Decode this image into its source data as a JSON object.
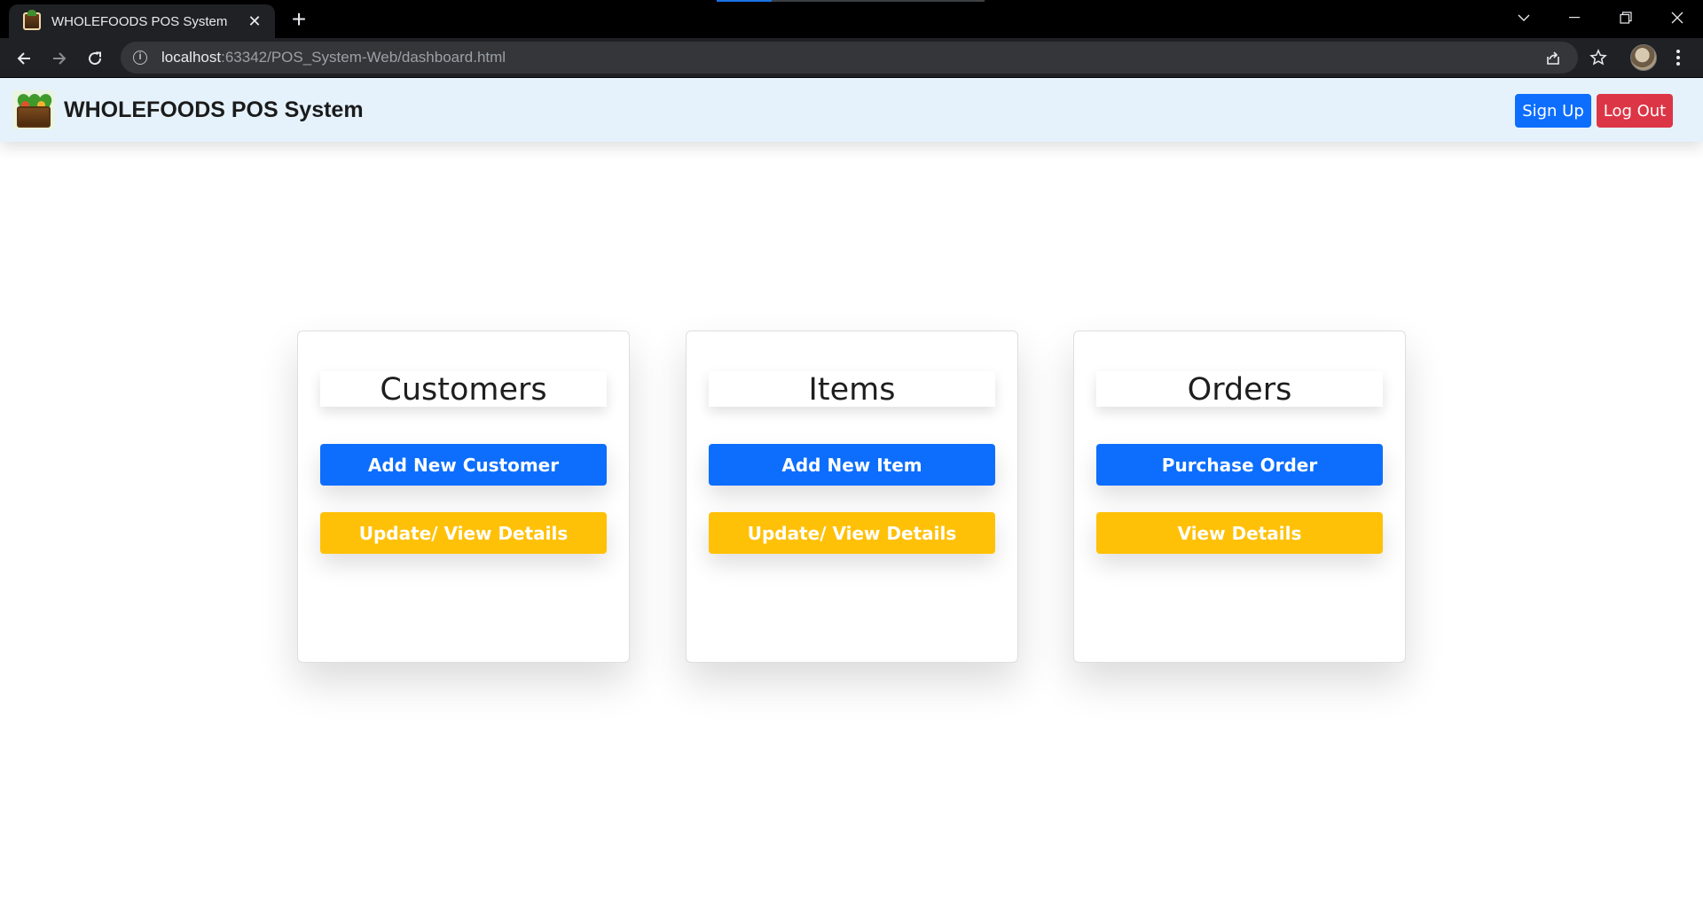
{
  "browser": {
    "tab_title": "WHOLEFOODS POS System",
    "url_host": "localhost",
    "url_rest": ":63342/POS_System-Web/dashboard.html"
  },
  "navbar": {
    "brand": "WHOLEFOODS POS System",
    "signup_label": "Sign Up",
    "logout_label": "Log Out"
  },
  "cards": [
    {
      "title": "Customers",
      "primary_label": "Add New Customer",
      "secondary_label": "Update/ View Details"
    },
    {
      "title": "Items",
      "primary_label": "Add New Item",
      "secondary_label": "Update/ View Details"
    },
    {
      "title": "Orders",
      "primary_label": "Purchase Order",
      "secondary_label": "View Details"
    }
  ],
  "colors": {
    "primary": "#0d6efd",
    "warning": "#ffc107",
    "danger": "#dc3545",
    "navbar_bg": "#e5f2fc"
  },
  "icons": [
    "close-icon",
    "plus-icon",
    "back-arrow-icon",
    "forward-arrow-icon",
    "reload-icon",
    "info-icon",
    "share-icon",
    "star-icon",
    "profile-avatar",
    "menu-dots-icon"
  ]
}
